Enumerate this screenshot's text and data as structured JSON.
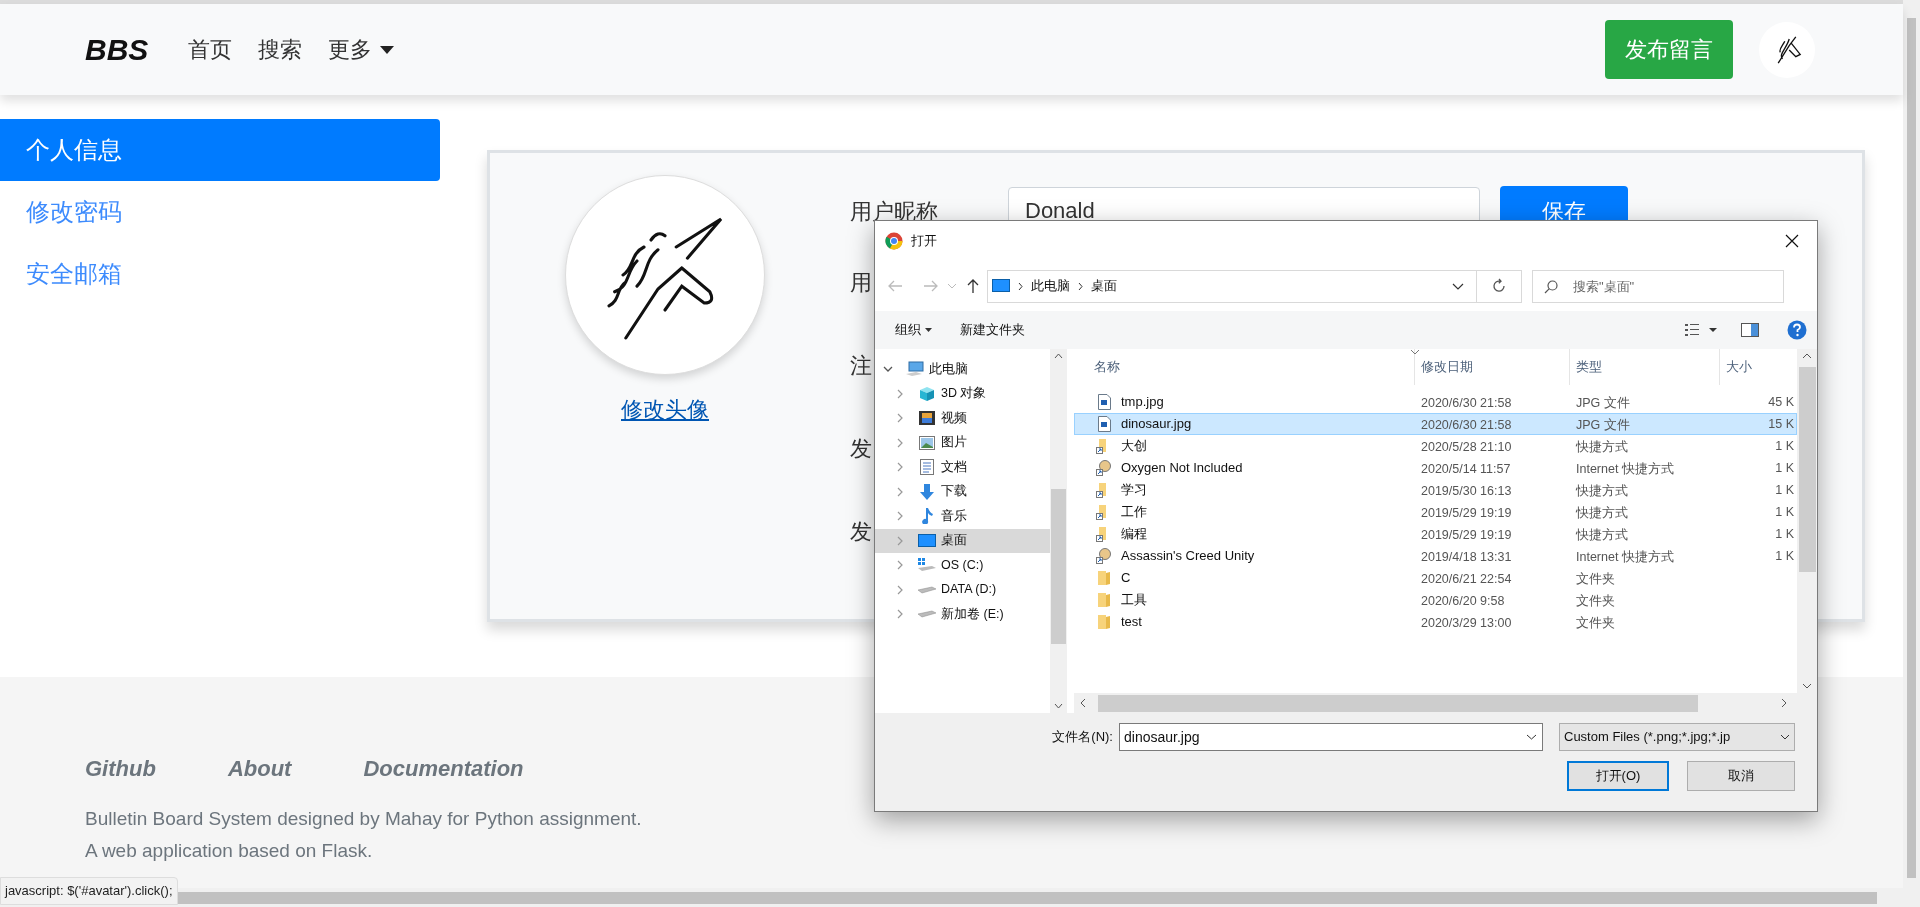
{
  "navbar": {
    "brand": "BBS",
    "links": [
      {
        "label": "首页",
        "dropdown": false
      },
      {
        "label": "搜索",
        "dropdown": false
      },
      {
        "label": "更多",
        "dropdown": true
      }
    ],
    "post_button": "发布留言"
  },
  "sidebar": {
    "items": [
      {
        "label": "个人信息",
        "selected": true
      },
      {
        "label": "修改密码",
        "selected": false
      },
      {
        "label": "安全邮箱",
        "selected": false
      }
    ]
  },
  "profile": {
    "change_avatar": "修改头像",
    "fields": [
      {
        "label": "用户昵称",
        "value": "Donald"
      },
      {
        "label": "用"
      },
      {
        "label": "注"
      },
      {
        "label": "发"
      },
      {
        "label": "发"
      }
    ],
    "save_button": "保存"
  },
  "footer": {
    "links": [
      "Github",
      "About",
      "Documentation"
    ],
    "lines": [
      "Bulletin Board System designed by Mahay for Python assignment.",
      "A web application based on Flask."
    ]
  },
  "status_tooltip": "javascript: $('#avatar').click();",
  "dialog": {
    "title": "打开",
    "breadcrumb": [
      "此电脑",
      "桌面"
    ],
    "search_placeholder": "搜索\"桌面\"",
    "organize": "组织",
    "new_folder": "新建文件夹",
    "nav_tree": [
      {
        "label": "此电脑",
        "kind": "pc",
        "expanded": true,
        "selected": false,
        "children": [
          {
            "label": "3D 对象",
            "kind": "cube",
            "expanded": false,
            "selected": false
          },
          {
            "label": "视频",
            "kind": "video",
            "expanded": false,
            "selected": false
          },
          {
            "label": "图片",
            "kind": "pictures",
            "expanded": false,
            "selected": false
          },
          {
            "label": "文档",
            "kind": "document",
            "expanded": false,
            "selected": false
          },
          {
            "label": "下载",
            "kind": "download",
            "expanded": false,
            "selected": false
          },
          {
            "label": "音乐",
            "kind": "music",
            "expanded": false,
            "selected": false
          },
          {
            "label": "桌面",
            "kind": "desktop",
            "expanded": false,
            "selected": true
          },
          {
            "label": "OS (C:)",
            "kind": "system-drive",
            "expanded": false,
            "selected": false
          },
          {
            "label": "DATA (D:)",
            "kind": "drive",
            "expanded": false,
            "selected": false
          },
          {
            "label": "新加卷 (E:)",
            "kind": "drive",
            "expanded": false,
            "selected": false
          }
        ]
      }
    ],
    "columns": [
      "名称",
      "修改日期",
      "类型",
      "大小"
    ],
    "files": [
      {
        "name": "tmp.jpg",
        "date": "2020/6/30 21:58",
        "type": "JPG 文件",
        "size": "45 K",
        "kind": "image",
        "selected": false
      },
      {
        "name": "dinosaur.jpg",
        "date": "2020/6/30 21:58",
        "type": "JPG 文件",
        "size": "15 K",
        "kind": "image",
        "selected": true
      },
      {
        "name": "大创",
        "date": "2020/5/28 21:10",
        "type": "快捷方式",
        "size": "1 K",
        "kind": "shortcut",
        "selected": false
      },
      {
        "name": "Oxygen Not Included",
        "date": "2020/5/14 11:57",
        "type": "Internet 快捷方式",
        "size": "1 K",
        "kind": "app-shortcut",
        "selected": false
      },
      {
        "name": "学习",
        "date": "2019/5/30 16:13",
        "type": "快捷方式",
        "size": "1 K",
        "kind": "shortcut",
        "selected": false
      },
      {
        "name": "工作",
        "date": "2019/5/29 19:19",
        "type": "快捷方式",
        "size": "1 K",
        "kind": "shortcut",
        "selected": false
      },
      {
        "name": "编程",
        "date": "2019/5/29 19:19",
        "type": "快捷方式",
        "size": "1 K",
        "kind": "shortcut",
        "selected": false
      },
      {
        "name": "Assassin's Creed Unity",
        "date": "2019/4/18 13:31",
        "type": "Internet 快捷方式",
        "size": "1 K",
        "kind": "app-shortcut",
        "selected": false
      },
      {
        "name": "C",
        "date": "2020/6/21 22:54",
        "type": "文件夹",
        "kind": "folder",
        "selected": false
      },
      {
        "name": "工具",
        "date": "2020/6/20 9:58",
        "type": "文件夹",
        "kind": "folder",
        "selected": false
      },
      {
        "name": "test",
        "date": "2020/3/29 13:00",
        "type": "文件夹",
        "kind": "folder",
        "selected": false
      }
    ],
    "filename_label": "文件名(N):",
    "filename_value": "dinosaur.jpg",
    "filter": "Custom Files (*.png;*.jpg;*.jp",
    "open_button": "打开(O)",
    "cancel_button": "取消"
  }
}
